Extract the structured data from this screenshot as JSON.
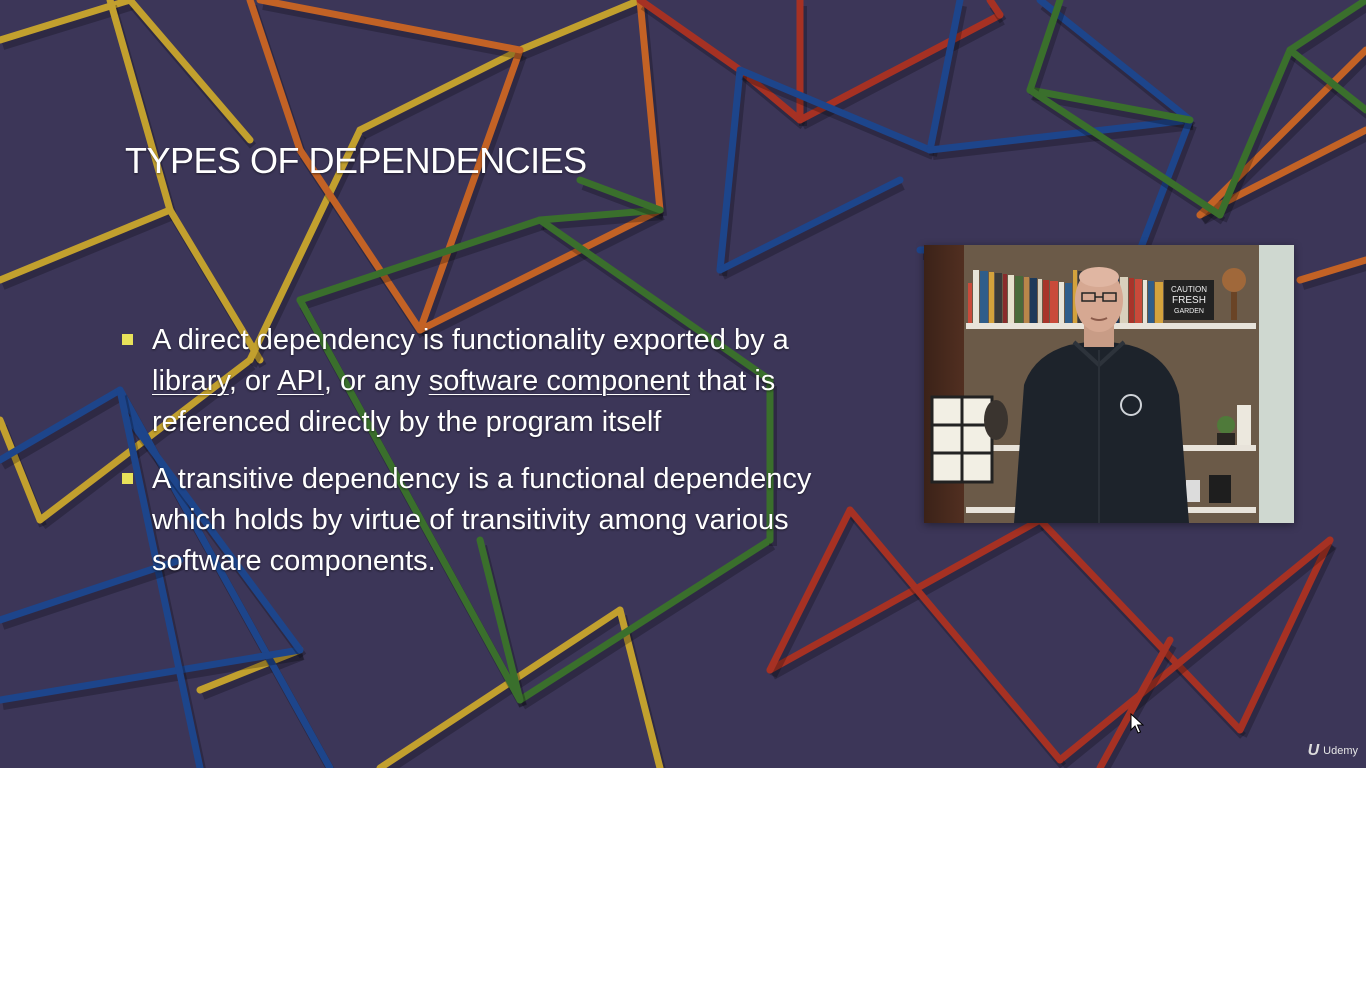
{
  "slide": {
    "title": "TYPES OF DEPENDENCIES",
    "bullets": [
      {
        "parts": [
          {
            "text": "A direct dependency is functionality exported by a ",
            "link": false
          },
          {
            "text": "library",
            "link": true
          },
          {
            "text": ", or ",
            "link": false
          },
          {
            "text": "API",
            "link": true
          },
          {
            "text": ", or any ",
            "link": false
          },
          {
            "text": "software component",
            "link": true
          },
          {
            "text": " that is referenced directly by the program itself",
            "link": false
          }
        ]
      },
      {
        "parts": [
          {
            "text": "A transitive dependency is a functional dependency which holds by virtue of transitivity among various software components.",
            "link": false
          }
        ]
      }
    ]
  },
  "webcam": {
    "sign_lines": [
      "CAUTION",
      "FRESH",
      "GARDEN"
    ]
  },
  "watermark": {
    "icon": "U",
    "brand": "Udemy"
  },
  "colors": {
    "background": "#3f3a5c",
    "bullet_marker": "#e8e25a",
    "rod_yellow": "#d8b22c",
    "rod_orange": "#d96c22",
    "rod_red": "#b8341f",
    "rod_blue": "#1c4a96",
    "rod_green": "#3d7a2a"
  }
}
